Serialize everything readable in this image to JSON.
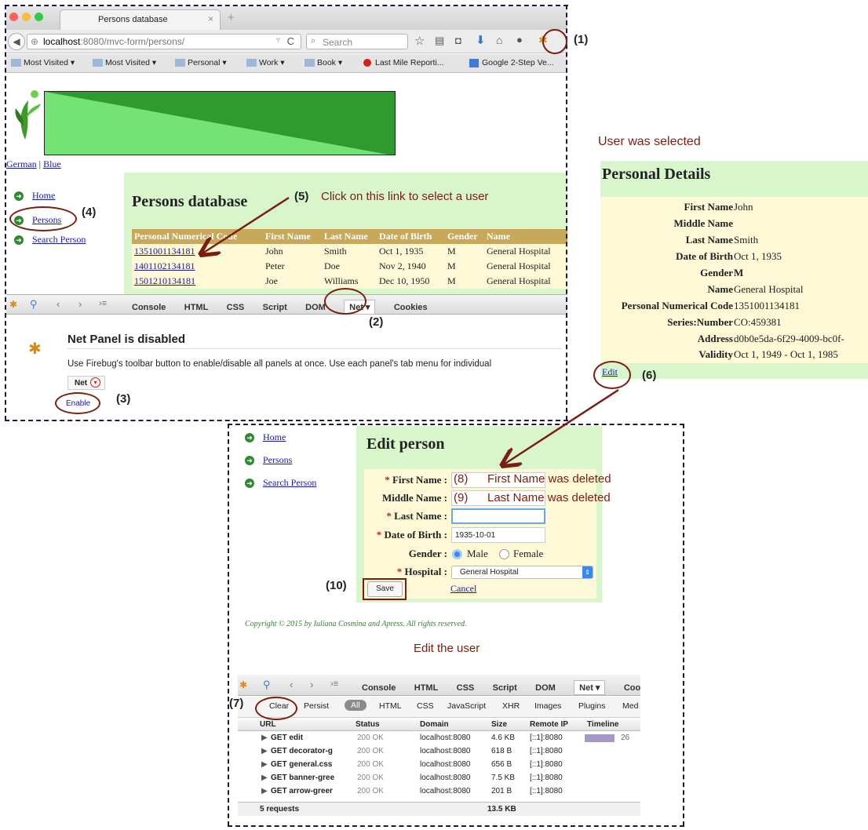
{
  "browser": {
    "tab_title": "Persons database",
    "url_host": "localhost",
    "url_rest": ":8080/mvc-form/persons/",
    "search_placeholder": "Search",
    "bookmarks": [
      "Most Visited",
      "Most Visited",
      "Personal",
      "Work",
      "Book",
      "Last Mile Reporti...",
      "Google 2-Step Ve..."
    ]
  },
  "page": {
    "lang_german": "German",
    "lang_sep": "|",
    "lang_blue": "Blue",
    "nav": [
      "Home",
      "Persons",
      "Search Person"
    ],
    "title": "Persons database",
    "table_headers": [
      "Personal Numerical Code",
      "First Name",
      "Last Name",
      "Date of Birth",
      "Gender",
      "Name"
    ],
    "rows": [
      [
        "1351001134181",
        "John",
        "Smith",
        "Oct 1, 1935",
        "M",
        "General Hospital"
      ],
      [
        "1401102134181",
        "Peter",
        "Doe",
        "Nov 2, 1940",
        "M",
        "General Hospital"
      ],
      [
        "1501210134181",
        "Joe",
        "Williams",
        "Dec 10, 1950",
        "M",
        "General Hospital"
      ]
    ]
  },
  "firebug_top": {
    "tabs": [
      "Console",
      "HTML",
      "CSS",
      "Script",
      "DOM",
      "Net ▾",
      "Cookies"
    ],
    "net_disabled_title": "Net Panel is disabled",
    "net_disabled_text": "Use Firebug's toolbar button to enable/disable all panels at once. Use each panel's tab menu for individual",
    "net_menu_label": "Net",
    "enable_label": "Enable"
  },
  "details": {
    "selected_note": "User was selected",
    "title": "Personal Details",
    "fields": [
      {
        "label": "First Name",
        "value": "John"
      },
      {
        "label": "Middle Name",
        "value": ""
      },
      {
        "label": "Last Name",
        "value": "Smith"
      },
      {
        "label": "Date of Birth",
        "value": "Oct 1, 1935"
      },
      {
        "label": "Gender",
        "value": "M"
      },
      {
        "label": "Name",
        "value": "General Hospital"
      },
      {
        "label": "Personal Numerical Code",
        "value": "1351001134181"
      },
      {
        "label": "Series:Number",
        "value": "CO:459381"
      },
      {
        "label": "Address",
        "value": "d0b0e5da-6f29-4009-bc0f-"
      },
      {
        "label": "Validity",
        "value": "Oct 1, 1949 - Oct 1, 1985"
      }
    ],
    "edit_link": "Edit"
  },
  "edit": {
    "nav": [
      "Home",
      "Persons",
      "Search Person"
    ],
    "title": "Edit person",
    "labels": {
      "first_name": "First Name :",
      "middle_name": "Middle Name :",
      "last_name": "Last Name :",
      "dob": "Date of Birth :",
      "gender": "Gender :",
      "hospital": "Hospital :"
    },
    "required_mark": "*",
    "dob_value": "1935-10-01",
    "gender_male": "Male",
    "gender_female": "Female",
    "hospital_value": "General Hospital",
    "save_label": "Save",
    "cancel_label": "Cancel",
    "copyright": "Copyright © 2015 by Iuliana Cosmina and Apress. All rights reserved.",
    "edit_note": "Edit the user"
  },
  "firebug_bottom": {
    "tabs": [
      "Console",
      "HTML",
      "CSS",
      "Script",
      "DOM",
      "Net ▾",
      "Cookie"
    ],
    "toolbar": [
      "Clear",
      "Persist",
      "All",
      "HTML",
      "CSS",
      "JavaScript",
      "XHR",
      "Images",
      "Plugins",
      "Med"
    ],
    "headers": [
      "URL",
      "Status",
      "Domain",
      "Size",
      "Remote IP",
      "Timeline"
    ],
    "rows": [
      [
        "GET edit",
        "200 OK",
        "localhost:8080",
        "4.6 KB",
        "[::1]:8080",
        "26"
      ],
      [
        "GET decorator-g",
        "200 OK",
        "localhost:8080",
        "618 B",
        "[::1]:8080",
        ""
      ],
      [
        "GET general.css",
        "200 OK",
        "localhost:8080",
        "656 B",
        "[::1]:8080",
        ""
      ],
      [
        "GET banner-gree",
        "200 OK",
        "localhost:8080",
        "7.5 KB",
        "[::1]:8080",
        ""
      ],
      [
        "GET arrow-greer",
        "200 OK",
        "localhost:8080",
        "201 B",
        "[::1]:8080",
        ""
      ]
    ],
    "summary_requests": "5 requests",
    "summary_size": "13.5 KB"
  },
  "annotations": {
    "a1": "(1)",
    "a2": "(2)",
    "a3": "(3)",
    "a4": "(4)",
    "a5": "(5)",
    "a5_text": "Click on this link to select a user",
    "a6": "(6)",
    "a7": "(7)",
    "a8": "(8)",
    "a8_text": "First Name was deleted",
    "a9": "(9)",
    "a9_text": "Last Name was deleted",
    "a10": "(10)"
  },
  "colors": {
    "annotation": "#7a1e10",
    "panel_green": "#d8f5cc",
    "table_header": "#c8a85a",
    "table_row": "#fdf8d6",
    "banner_dark": "#2f9a2f",
    "banner_light": "#6fe06f"
  }
}
